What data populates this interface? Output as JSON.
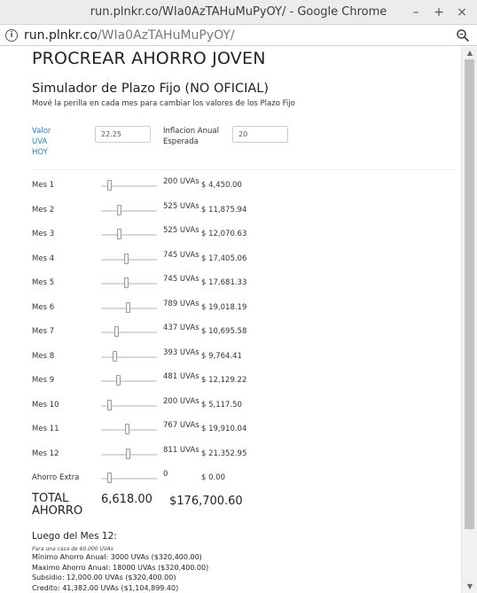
{
  "window": {
    "title": "run.plnkr.co/WIa0AzTAHuMuPyOY/ - Google Chrome",
    "url_host": "run.plnkr.co",
    "url_path": "/WIa0AzTAHuMuPyOY/"
  },
  "page": {
    "title": "PROCREAR AHORRO JOVEN",
    "subtitle": "Simulador de Plazo Fijo (NO OFICIAL)",
    "hint": "Mové la perilla en cada mes para cambiar los valores de los Plazo Fijo"
  },
  "params": {
    "valor_label_1": "Valor",
    "valor_label_2": "UVA",
    "valor_label_3": "HOY",
    "valor_value": "22.25",
    "inflacion_label_1": "Inflacion Anual",
    "inflacion_label_2": "Esperada",
    "inflacion_value": "20"
  },
  "rows": [
    {
      "label": "Mes 1",
      "uvas": "200 UVAs",
      "pesos": "$ 4,450.00",
      "level": 0.12
    },
    {
      "label": "Mes 2",
      "uvas": "525 UVAs",
      "pesos": "$ 11,875.94",
      "level": 0.31
    },
    {
      "label": "Mes 3",
      "uvas": "525 UVAs",
      "pesos": "$ 12,070.63",
      "level": 0.31
    },
    {
      "label": "Mes 4",
      "uvas": "745 UVAs",
      "pesos": "$ 17,405.06",
      "level": 0.45
    },
    {
      "label": "Mes 5",
      "uvas": "745 UVAs",
      "pesos": "$ 17,681.33",
      "level": 0.45
    },
    {
      "label": "Mes 6",
      "uvas": "789 UVAs",
      "pesos": "$ 19,018.19",
      "level": 0.48
    },
    {
      "label": "Mes 7",
      "uvas": "437 UVAs",
      "pesos": "$ 10,695.58",
      "level": 0.25
    },
    {
      "label": "Mes 8",
      "uvas": "393 UVAs",
      "pesos": "$ 9,764.41",
      "level": 0.23
    },
    {
      "label": "Mes 9",
      "uvas": "481 UVAs",
      "pesos": "$ 12,129.22",
      "level": 0.29
    },
    {
      "label": "Mes 10",
      "uvas": "200 UVAs",
      "pesos": "$ 5,117.50",
      "level": 0.12
    },
    {
      "label": "Mes 11",
      "uvas": "767 UVAs",
      "pesos": "$ 19,910.04",
      "level": 0.46
    },
    {
      "label": "Mes 12",
      "uvas": "811 UVAs",
      "pesos": "$ 21,352.95",
      "level": 0.49
    },
    {
      "label": "Ahorro Extra",
      "uvas": "0",
      "pesos": "$ 0.00",
      "level": 0.12
    }
  ],
  "total": {
    "label_1": "TOTAL",
    "label_2": "AHORRO",
    "uvas": "6,618.00",
    "pesos": "$176,700.60"
  },
  "luego": {
    "heading": "Luego del Mes 12:",
    "note": "Para una casa de 60.000 UVAs",
    "lines": [
      "Mínimo Ahorro Anual: 3000 UVAs ($320,400.00)",
      "Maximo Ahorro Anual: 18000 UVAs ($320,400.00)",
      "Subsidio: 12,000.00 UVAs ($320,400.00)",
      "Credito: 41,382.00 UVAs ($1,104,899.40)"
    ]
  }
}
